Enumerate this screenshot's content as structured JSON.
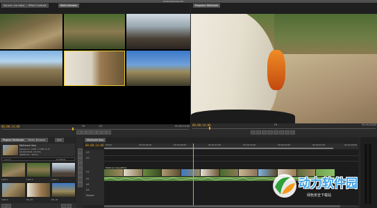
{
  "app": {
    "window_title": "Adobe Premiere Pro",
    "left_monitor": {
      "tabs": [
        "Source: (no clips)",
        "Effect Controls",
        "Audio Clip Mixer",
        "Metadata"
      ],
      "active_tab": "Multi-Camera",
      "timecode_in": "00;00;14;00",
      "timecode_out": "00;00;00;00",
      "fit_label": "Fit",
      "page_label": "1/2",
      "duration": "00;00;14;00"
    },
    "right_monitor": {
      "tab": "Program: Multicam",
      "timecode": "00;00;14;00",
      "fit_label": "Fit",
      "duration": "00;00;28;00"
    },
    "project_panel": {
      "tabs": [
        "Project: Multicam",
        "Media Browser",
        "Info"
      ],
      "selected_name": "Multicam Seq",
      "info_lines": [
        "Sequence, 1920 x 1080 (1.0)",
        "00;00;28;00, 29.97p",
        "48000 Hz - Stereo"
      ],
      "search_placeholder": "Search",
      "items_count": "12 Items",
      "clips": [
        "CAM 1",
        "CAM 2",
        "CAM 3",
        "CAM 4",
        "GP_01",
        "GP_02",
        "GP_03",
        "GP_04"
      ]
    },
    "timeline": {
      "tab": "Multicam Seq",
      "timecode": "00;00;14;00",
      "ruler": [
        "00;00",
        "00;00;04;00",
        "00;00;08;00",
        "00;00;12;00",
        "00;00;16;00",
        "00;00;20;00",
        "00;00;24;00",
        "00;00;28;00"
      ],
      "tracks": [
        "V3",
        "V2",
        "V1",
        "A1",
        "A2",
        "A3",
        "Master"
      ],
      "clip_label": "Multicam Seq [MC1]"
    },
    "watermark": {
      "text": "动力软件园",
      "subtext": "绿色安全下载站"
    },
    "colors": {
      "timecode": "#e7a526",
      "clip_green": "#8fbf6a",
      "playhead": "#e7a526"
    }
  }
}
